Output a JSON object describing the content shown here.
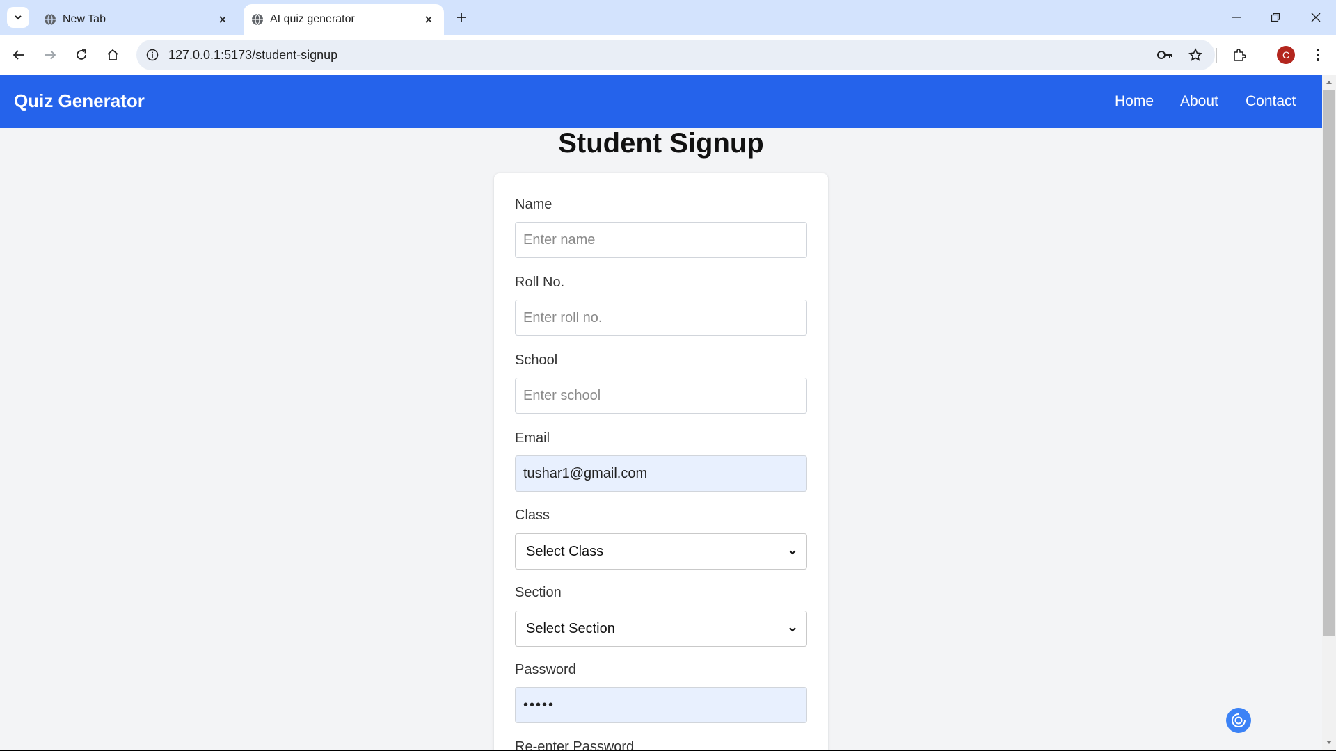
{
  "browser": {
    "tabs": [
      {
        "title": "New Tab",
        "active": false
      },
      {
        "title": "AI quiz generator",
        "active": true
      }
    ],
    "url": "127.0.0.1:5173/student-signup",
    "profile_initial": "C"
  },
  "navbar": {
    "brand": "Quiz Generator",
    "links": [
      "Home",
      "About",
      "Contact"
    ]
  },
  "page": {
    "title": "Student Signup"
  },
  "form": {
    "name": {
      "label": "Name",
      "placeholder": "Enter name",
      "value": ""
    },
    "roll": {
      "label": "Roll No.",
      "placeholder": "Enter roll no.",
      "value": ""
    },
    "school": {
      "label": "School",
      "placeholder": "Enter school",
      "value": ""
    },
    "email": {
      "label": "Email",
      "value": "tushar1@gmail.com"
    },
    "class": {
      "label": "Class",
      "selected": "Select Class"
    },
    "section": {
      "label": "Section",
      "selected": "Select Section"
    },
    "password": {
      "label": "Password",
      "value": "•••••"
    },
    "reenter": {
      "label": "Re-enter Password"
    }
  },
  "colors": {
    "navbar": "#2563eb",
    "page_bg": "#f3f4f6",
    "autofill_bg": "#e8f0fe",
    "avatar": "#b3261e"
  }
}
